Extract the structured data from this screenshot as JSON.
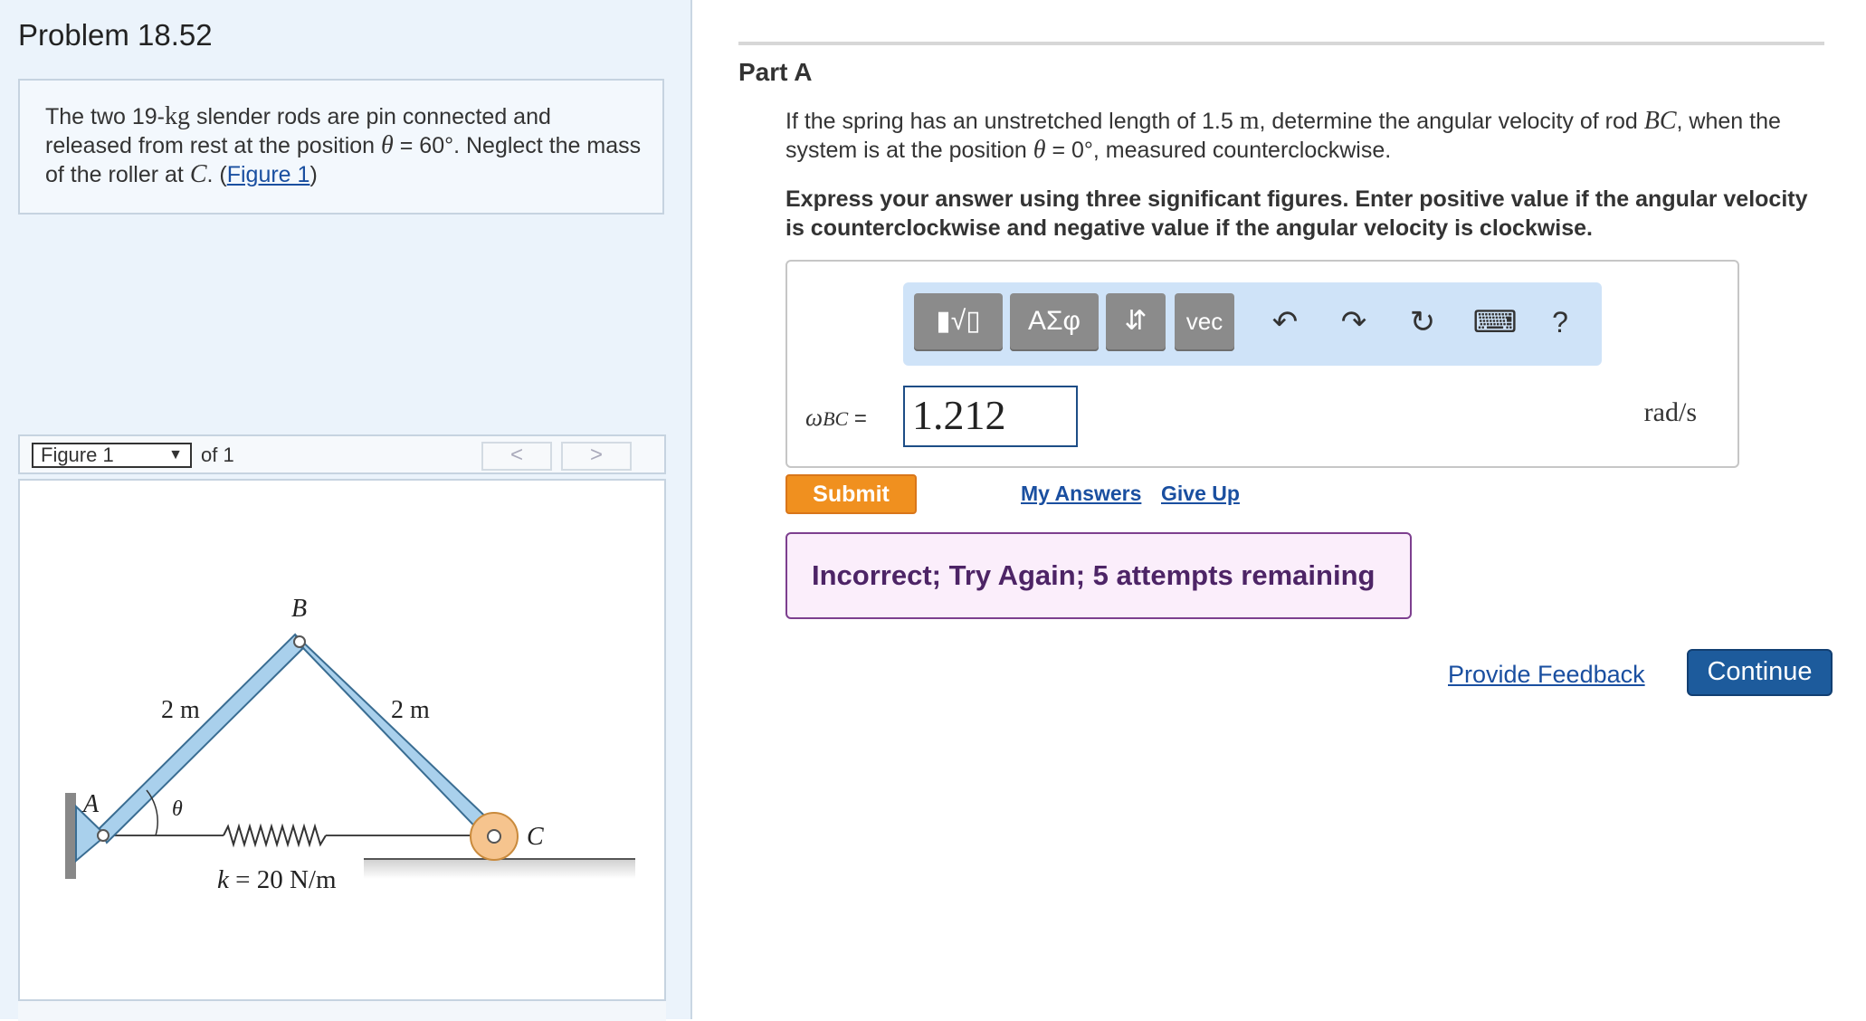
{
  "problem": {
    "title": "Problem 18.52",
    "text_1": "The two 19-",
    "text_kg": "kg",
    "text_2": " slender rods are pin connected and released from rest at the position ",
    "theta": "θ",
    "text_3": " = 60°. Neglect the mass of the roller at ",
    "point_c": "C",
    "text_4": ". (",
    "figure_link": "Figure 1",
    "text_5": ")"
  },
  "figure_nav": {
    "selected": "Figure 1",
    "of_label": "of 1",
    "prev_label": "<",
    "next_label": ">"
  },
  "figure": {
    "label_a": "A",
    "label_b": "B",
    "label_c": "C",
    "label_theta": "θ",
    "length_ab": "2 m",
    "length_bc": "2 m",
    "spring_k": "k",
    "spring_val": " = 20 N/m"
  },
  "part": {
    "title": "Part A",
    "q_1": "If the spring has an unstretched length of 1.5 ",
    "q_m": "m",
    "q_2": ", determine the angular velocity of rod ",
    "q_bc": "BC",
    "q_3": ", when the system is at the position ",
    "q_theta": "θ",
    "q_4": " = 0°, measured counterclockwise.",
    "instructions": "Express your answer using three significant figures. Enter positive value if the angular velocity is counterclockwise and negative value if the angular velocity is clockwise."
  },
  "toolbar": {
    "templates_label": "▮√▯",
    "greek_label": "ΑΣφ",
    "arrows_label": "⇵",
    "vec_label": "vec",
    "undo_icon": "↶",
    "redo_icon": "↷",
    "reset_icon": "↻",
    "keyboard_icon": "⌨",
    "help_label": "?"
  },
  "answer": {
    "omega": "ω",
    "sub": "BC",
    "equals": " =",
    "value": "1.212",
    "units": "rad/s"
  },
  "actions": {
    "submit": "Submit",
    "my_answers": "My Answers",
    "give_up": "Give Up",
    "feedback_message": "Incorrect; Try Again; 5 attempts remaining",
    "provide_feedback": "Provide Feedback",
    "continue": "Continue"
  },
  "colors": {
    "submit": "#f0901f",
    "continue": "#1d5b9c",
    "link": "#1a4fa0",
    "incorrect_bg": "#fbeefb",
    "incorrect_border": "#7d3f8f",
    "rod": "#a9d0ec",
    "roller": "#f6c48e"
  }
}
